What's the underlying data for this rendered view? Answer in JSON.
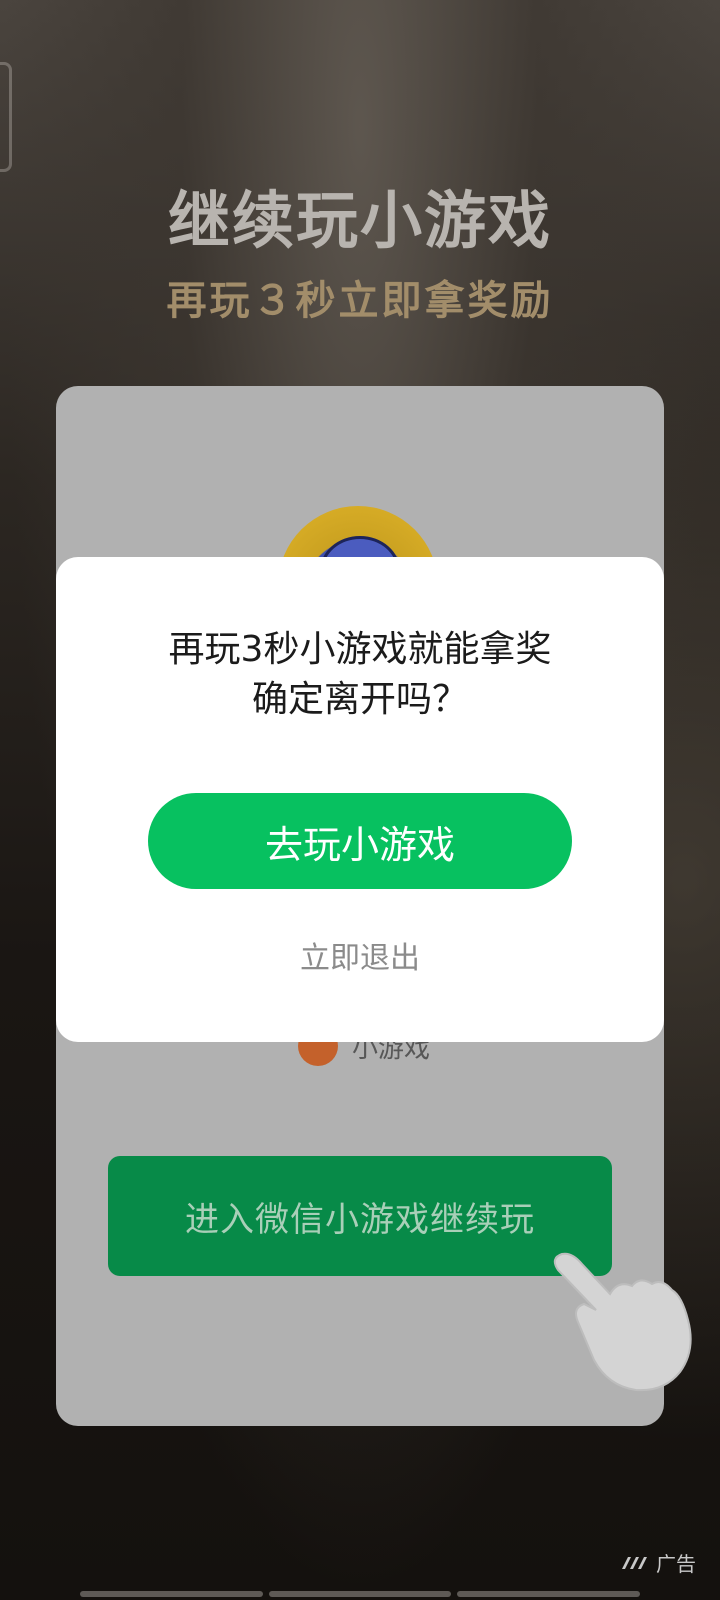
{
  "background": {
    "headline": "继续玩小游戏",
    "subline": "再玩３秒立即拿奖励"
  },
  "card": {
    "minigame_label": "小游戏",
    "continue_button": "进入微信小游戏继续玩"
  },
  "dialog": {
    "message_line1": "再玩3秒小游戏就能拿奖",
    "message_line2": "确定离开吗？",
    "primary_button": "去玩小游戏",
    "exit_link": "立即退出"
  },
  "ad": {
    "label": "广告"
  },
  "colors": {
    "primary_green": "#07c160",
    "subline_gold": "#a28d6a"
  },
  "icons": {
    "hand": "pointing-hand-icon",
    "ad_logo": "ad-brand-icon"
  }
}
